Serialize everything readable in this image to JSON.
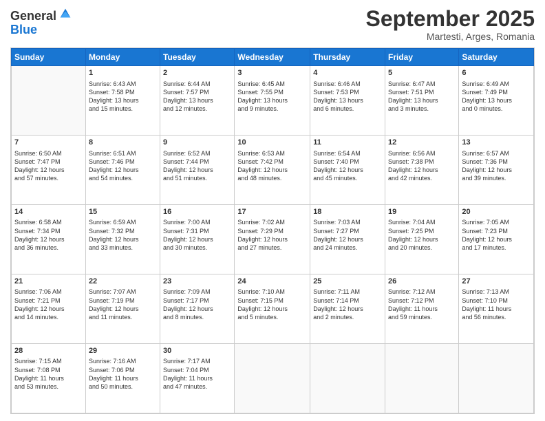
{
  "logo": {
    "line1": "General",
    "line2": "Blue"
  },
  "title": "September 2025",
  "location": "Martesti, Arges, Romania",
  "weekdays": [
    "Sunday",
    "Monday",
    "Tuesday",
    "Wednesday",
    "Thursday",
    "Friday",
    "Saturday"
  ],
  "weeks": [
    [
      {
        "day": "",
        "info": ""
      },
      {
        "day": "1",
        "info": "Sunrise: 6:43 AM\nSunset: 7:58 PM\nDaylight: 13 hours\nand 15 minutes."
      },
      {
        "day": "2",
        "info": "Sunrise: 6:44 AM\nSunset: 7:57 PM\nDaylight: 13 hours\nand 12 minutes."
      },
      {
        "day": "3",
        "info": "Sunrise: 6:45 AM\nSunset: 7:55 PM\nDaylight: 13 hours\nand 9 minutes."
      },
      {
        "day": "4",
        "info": "Sunrise: 6:46 AM\nSunset: 7:53 PM\nDaylight: 13 hours\nand 6 minutes."
      },
      {
        "day": "5",
        "info": "Sunrise: 6:47 AM\nSunset: 7:51 PM\nDaylight: 13 hours\nand 3 minutes."
      },
      {
        "day": "6",
        "info": "Sunrise: 6:49 AM\nSunset: 7:49 PM\nDaylight: 13 hours\nand 0 minutes."
      }
    ],
    [
      {
        "day": "7",
        "info": "Sunrise: 6:50 AM\nSunset: 7:47 PM\nDaylight: 12 hours\nand 57 minutes."
      },
      {
        "day": "8",
        "info": "Sunrise: 6:51 AM\nSunset: 7:46 PM\nDaylight: 12 hours\nand 54 minutes."
      },
      {
        "day": "9",
        "info": "Sunrise: 6:52 AM\nSunset: 7:44 PM\nDaylight: 12 hours\nand 51 minutes."
      },
      {
        "day": "10",
        "info": "Sunrise: 6:53 AM\nSunset: 7:42 PM\nDaylight: 12 hours\nand 48 minutes."
      },
      {
        "day": "11",
        "info": "Sunrise: 6:54 AM\nSunset: 7:40 PM\nDaylight: 12 hours\nand 45 minutes."
      },
      {
        "day": "12",
        "info": "Sunrise: 6:56 AM\nSunset: 7:38 PM\nDaylight: 12 hours\nand 42 minutes."
      },
      {
        "day": "13",
        "info": "Sunrise: 6:57 AM\nSunset: 7:36 PM\nDaylight: 12 hours\nand 39 minutes."
      }
    ],
    [
      {
        "day": "14",
        "info": "Sunrise: 6:58 AM\nSunset: 7:34 PM\nDaylight: 12 hours\nand 36 minutes."
      },
      {
        "day": "15",
        "info": "Sunrise: 6:59 AM\nSunset: 7:32 PM\nDaylight: 12 hours\nand 33 minutes."
      },
      {
        "day": "16",
        "info": "Sunrise: 7:00 AM\nSunset: 7:31 PM\nDaylight: 12 hours\nand 30 minutes."
      },
      {
        "day": "17",
        "info": "Sunrise: 7:02 AM\nSunset: 7:29 PM\nDaylight: 12 hours\nand 27 minutes."
      },
      {
        "day": "18",
        "info": "Sunrise: 7:03 AM\nSunset: 7:27 PM\nDaylight: 12 hours\nand 24 minutes."
      },
      {
        "day": "19",
        "info": "Sunrise: 7:04 AM\nSunset: 7:25 PM\nDaylight: 12 hours\nand 20 minutes."
      },
      {
        "day": "20",
        "info": "Sunrise: 7:05 AM\nSunset: 7:23 PM\nDaylight: 12 hours\nand 17 minutes."
      }
    ],
    [
      {
        "day": "21",
        "info": "Sunrise: 7:06 AM\nSunset: 7:21 PM\nDaylight: 12 hours\nand 14 minutes."
      },
      {
        "day": "22",
        "info": "Sunrise: 7:07 AM\nSunset: 7:19 PM\nDaylight: 12 hours\nand 11 minutes."
      },
      {
        "day": "23",
        "info": "Sunrise: 7:09 AM\nSunset: 7:17 PM\nDaylight: 12 hours\nand 8 minutes."
      },
      {
        "day": "24",
        "info": "Sunrise: 7:10 AM\nSunset: 7:15 PM\nDaylight: 12 hours\nand 5 minutes."
      },
      {
        "day": "25",
        "info": "Sunrise: 7:11 AM\nSunset: 7:14 PM\nDaylight: 12 hours\nand 2 minutes."
      },
      {
        "day": "26",
        "info": "Sunrise: 7:12 AM\nSunset: 7:12 PM\nDaylight: 11 hours\nand 59 minutes."
      },
      {
        "day": "27",
        "info": "Sunrise: 7:13 AM\nSunset: 7:10 PM\nDaylight: 11 hours\nand 56 minutes."
      }
    ],
    [
      {
        "day": "28",
        "info": "Sunrise: 7:15 AM\nSunset: 7:08 PM\nDaylight: 11 hours\nand 53 minutes."
      },
      {
        "day": "29",
        "info": "Sunrise: 7:16 AM\nSunset: 7:06 PM\nDaylight: 11 hours\nand 50 minutes."
      },
      {
        "day": "30",
        "info": "Sunrise: 7:17 AM\nSunset: 7:04 PM\nDaylight: 11 hours\nand 47 minutes."
      },
      {
        "day": "",
        "info": ""
      },
      {
        "day": "",
        "info": ""
      },
      {
        "day": "",
        "info": ""
      },
      {
        "day": "",
        "info": ""
      }
    ]
  ]
}
